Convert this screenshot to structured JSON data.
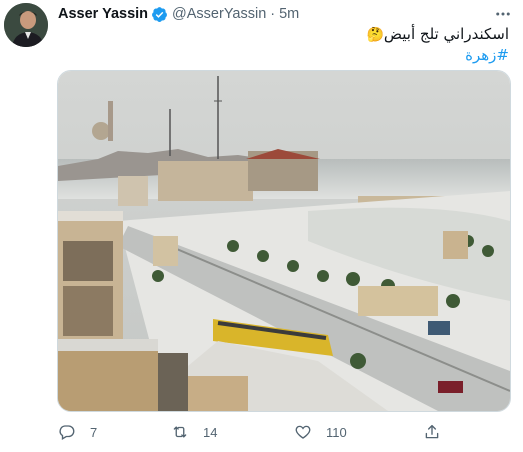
{
  "tweet": {
    "author_name": "Asser Yassin",
    "handle": "@AsserYassin",
    "separator": "·",
    "time": "5m",
    "text": "اسكندراني تلج أبيض",
    "emoji": "🤔",
    "hashtag": "#زهرة"
  },
  "actions": {
    "replies": "7",
    "retweets": "14",
    "likes": "110"
  },
  "icons": {
    "verified": "verified-badge-icon",
    "more": "more-icon",
    "reply": "reply-icon",
    "retweet": "retweet-icon",
    "like": "heart-icon",
    "share": "share-icon"
  },
  "colors": {
    "accent": "#1d9bf0",
    "secondary_text": "#536471"
  }
}
